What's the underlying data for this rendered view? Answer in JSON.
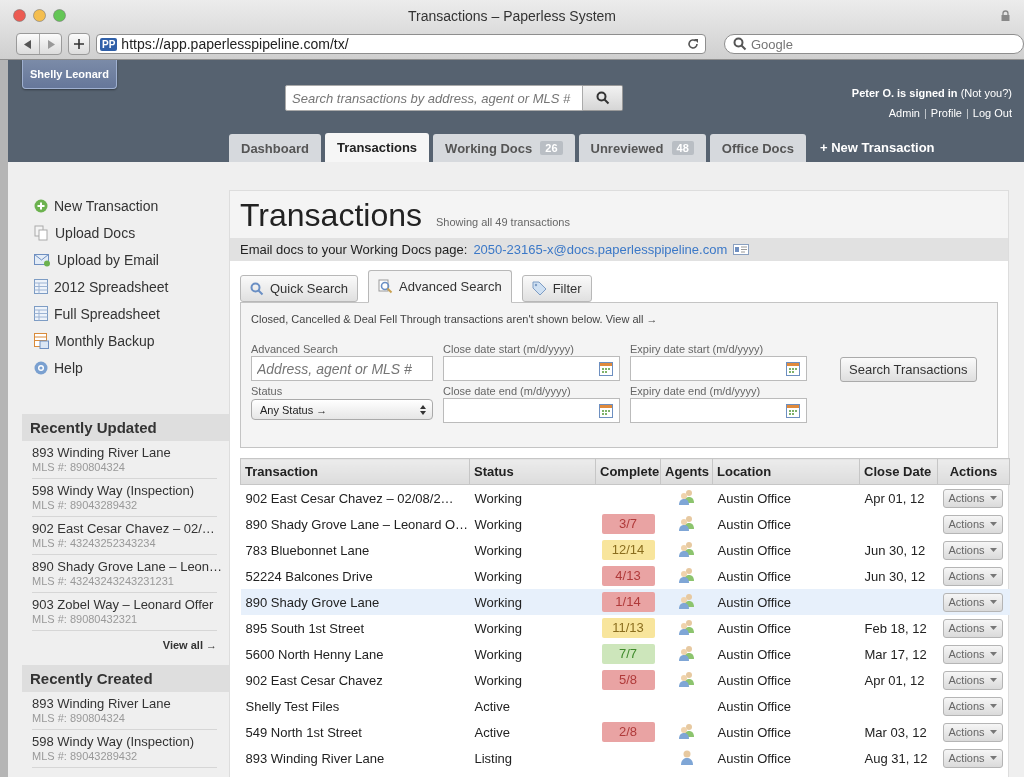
{
  "window": {
    "title": "Transactions – Paperless System"
  },
  "browser": {
    "favicon": "PP",
    "url": "https://app.paperlesspipeline.com/tx/",
    "search_placeholder": "Google"
  },
  "header": {
    "user_tag": "Shelly Leonard",
    "search": {
      "placeholder": "Search transactions by address, agent or MLS #"
    },
    "signed_in": "Peter O. is signed in",
    "not_you": "(Not you?)",
    "links": [
      {
        "kind": "link",
        "label": "Admin"
      },
      {
        "kind": "separator",
        "label": "|"
      },
      {
        "kind": "link",
        "label": "Profile"
      },
      {
        "kind": "separator",
        "label": "|"
      },
      {
        "kind": "link",
        "label": "Log Out"
      }
    ]
  },
  "tabs": [
    {
      "label": "Dashboard",
      "selected": false
    },
    {
      "label": "Transactions",
      "selected": true
    },
    {
      "label": "Working Docs",
      "count": "26",
      "selected": false
    },
    {
      "label": "Unreviewed",
      "count": "48",
      "selected": false
    },
    {
      "label": "Office Docs",
      "selected": false
    }
  ],
  "new_transaction_link": "+ New Transaction",
  "sidebar": {
    "actions": [
      {
        "kind": "add",
        "label": "New Transaction"
      },
      {
        "kind": "docs",
        "label": "Upload Docs"
      },
      {
        "kind": "email",
        "label": "Upload by Email"
      },
      {
        "kind": "spreadsheet",
        "label": "2012 Spreadsheet"
      },
      {
        "kind": "spreadsheet",
        "label": "Full Spreadsheet"
      },
      {
        "kind": "backup",
        "label": "Monthly Backup"
      },
      {
        "kind": "help",
        "label": "Help"
      }
    ],
    "recently_updated": {
      "title": "Recently Updated",
      "items": [
        {
          "name": "893 Winding River Lane",
          "mls": "MLS #: 890804324"
        },
        {
          "name": "598 Windy Way (Inspection)",
          "mls": "MLS #: 89043289432"
        },
        {
          "name": "902 East Cesar Chavez – 02/…",
          "mls": "MLS #: 43243252343234"
        },
        {
          "name": "890 Shady Grove Lane – Leon…",
          "mls": "MLS #: 43243243243231231"
        },
        {
          "name": "903 Zobel Way – Leonard Offer",
          "mls": "MLS #: 89080432321"
        }
      ],
      "view_all": "View all →"
    },
    "recently_created": {
      "title": "Recently Created",
      "items": [
        {
          "name": "893 Winding River Lane",
          "mls": "MLS #: 890804324"
        },
        {
          "name": "598 Windy Way (Inspection)",
          "mls": "MLS #: 89043289432"
        }
      ]
    }
  },
  "main": {
    "title": "Transactions",
    "subtitle": "Showing all 49 transactions",
    "email_bar": {
      "label": "Email docs to your Working Docs page:",
      "address": "2050-23165-x@docs.paperlesspipeline.com"
    },
    "search_tabs": [
      {
        "kind": "quick",
        "label": "Quick Search",
        "selected": false
      },
      {
        "kind": "advanced",
        "label": "Advanced Search",
        "selected": true
      },
      {
        "kind": "filter",
        "label": "Filter",
        "selected": false
      }
    ],
    "notice": {
      "text": "Closed, Cancelled & Deal Fell Through transactions aren't shown below.",
      "link": "View all →"
    },
    "fields": [
      {
        "kind": "text",
        "label": "Advanced Search",
        "placeholder": "Address, agent or MLS #"
      },
      {
        "kind": "date",
        "label": "Close date start (m/d/yyyy)"
      },
      {
        "kind": "date",
        "label": "Expiry date start (m/d/yyyy)"
      },
      {
        "kind": "select",
        "label": "Status",
        "value": "Any Status →"
      },
      {
        "kind": "date",
        "label": "Close date end (m/d/yyyy)"
      },
      {
        "kind": "date",
        "label": "Expiry date end (m/d/yyyy)"
      }
    ],
    "search_button": "Search Transactions"
  },
  "table": {
    "columns": [
      "Transaction",
      "Status",
      "Complete",
      "Agents",
      "Location",
      "Close Date",
      "Actions"
    ],
    "rows": [
      {
        "transaction": "902 East Cesar Chavez – 02/08/2…",
        "status": "Working",
        "agents": {
          "kind": "multi"
        },
        "location": "Austin Office",
        "close_date": "Apr 01, 12",
        "action": "Actions",
        "selected": false
      },
      {
        "transaction": "890 Shady Grove Lane – Leonard O…",
        "status": "Working",
        "complete": {
          "label": "3/7",
          "color": "#e9a3a3"
        },
        "agents": {
          "kind": "multi"
        },
        "location": "Austin Office",
        "action": "Actions",
        "selected": false
      },
      {
        "transaction": "783 Bluebonnet Lane",
        "status": "Working",
        "complete": {
          "label": "12/14",
          "color": "#f8e59c"
        },
        "agents": {
          "kind": "multi"
        },
        "location": "Austin Office",
        "close_date": "Jun 30, 12",
        "action": "Actions",
        "selected": false
      },
      {
        "transaction": "52224 Balcones Drive",
        "status": "Working",
        "complete": {
          "label": "4/13",
          "color": "#e9a3a3"
        },
        "agents": {
          "kind": "multi"
        },
        "location": "Austin Office",
        "close_date": "Jun 30, 12",
        "action": "Actions",
        "selected": false
      },
      {
        "transaction": "890 Shady Grove Lane",
        "status": "Working",
        "complete": {
          "label": "1/14",
          "color": "#e9a3a3"
        },
        "agents": {
          "kind": "multi"
        },
        "location": "Austin Office",
        "action": "Actions",
        "selected": true
      },
      {
        "transaction": "895 South 1st Street",
        "status": "Working",
        "complete": {
          "label": "11/13",
          "color": "#f8e59c"
        },
        "agents": {
          "kind": "multi"
        },
        "location": "Austin Office",
        "close_date": "Feb 18, 12",
        "action": "Actions",
        "selected": false
      },
      {
        "transaction": "5600 North Henny Lane",
        "status": "Working",
        "complete": {
          "label": "7/7",
          "color": "#cde6bb"
        },
        "agents": {
          "kind": "multi"
        },
        "location": "Austin Office",
        "close_date": "Mar 17, 12",
        "action": "Actions",
        "selected": false
      },
      {
        "transaction": "902 East Cesar Chavez",
        "status": "Working",
        "complete": {
          "label": "5/8",
          "color": "#e9a3a3"
        },
        "agents": {
          "kind": "multi"
        },
        "location": "Austin Office",
        "close_date": "Apr 01, 12",
        "action": "Actions",
        "selected": false
      },
      {
        "transaction": "Shelly Test Files",
        "status": "Active",
        "location": "Austin Office",
        "action": "Actions",
        "selected": false
      },
      {
        "transaction": "549 North 1st Street",
        "status": "Active",
        "complete": {
          "label": "2/8",
          "color": "#e9a3a3"
        },
        "agents": {
          "kind": "multi"
        },
        "location": "Austin Office",
        "close_date": "Mar 03, 12",
        "action": "Actions",
        "selected": false
      },
      {
        "transaction": "893 Winding River Lane",
        "status": "Listing",
        "agents": {
          "kind": "single"
        },
        "location": "Austin Office",
        "close_date": "Aug 31, 12",
        "action": "Actions",
        "selected": false
      }
    ]
  }
}
